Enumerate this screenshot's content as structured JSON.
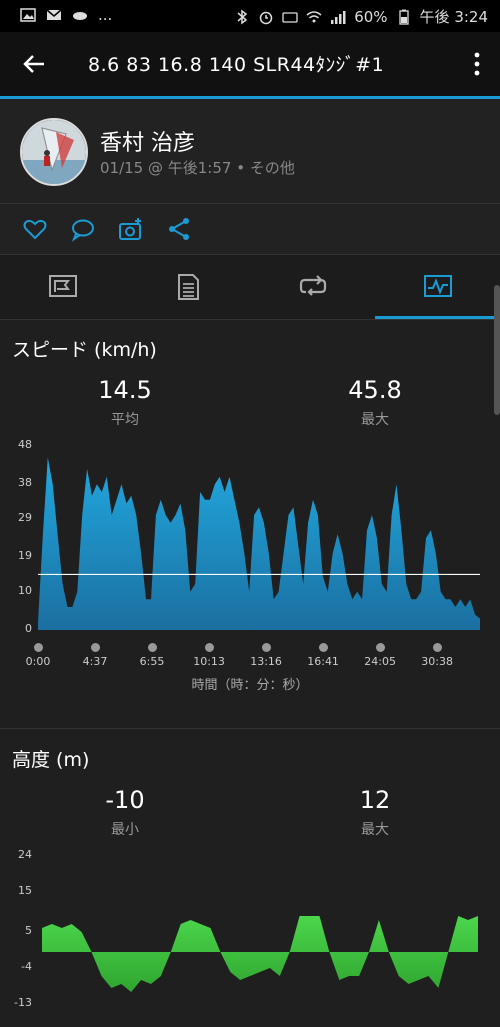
{
  "status_bar": {
    "left_icons": [
      "image-icon",
      "mail-icon",
      "cloud-icon"
    ],
    "overflow": "...",
    "battery": "60%",
    "time": "午後 3:24"
  },
  "header": {
    "title": "8.6  83  16.8   140   SLR44ﾀﾝｼﾞ#1"
  },
  "profile": {
    "name": "香村 治彦",
    "meta": "01/15 @ 午後1:57 • その他"
  },
  "actions": [
    "heart-icon",
    "comment-icon",
    "add-photo-icon",
    "share-icon"
  ],
  "tabs": [
    {
      "name": "summary",
      "icon": "flag-icon"
    },
    {
      "name": "details",
      "icon": "document-icon"
    },
    {
      "name": "laps",
      "icon": "loop-icon"
    },
    {
      "name": "charts",
      "icon": "chart-icon",
      "active": true
    }
  ],
  "speed": {
    "title": "スピード (km/h)",
    "avg_value": "14.5",
    "avg_label": "平均",
    "max_value": "45.8",
    "max_label": "最大",
    "y_ticks": [
      "48",
      "38",
      "29",
      "19",
      "10",
      "0"
    ],
    "x_ticks": [
      "0:00",
      "4:37",
      "6:55",
      "10:13",
      "13:16",
      "16:41",
      "24:05",
      "30:38"
    ],
    "x_caption": "時間（時：分：秒）"
  },
  "elevation": {
    "title": "高度 (m)",
    "min_value": "-10",
    "min_label": "最小",
    "max_value": "12",
    "max_label": "最大",
    "y_ticks": [
      "24",
      "15",
      "5",
      "-4",
      "-13"
    ]
  },
  "colors": {
    "accent": "#1a9bd4",
    "speed_fill": "#1e9ed2",
    "elevation_fill": "#3fbf3f",
    "background": "#1f1f1f"
  },
  "chart_data": [
    {
      "type": "area",
      "title": "スピード (km/h)",
      "xlabel": "時間（時：分：秒）",
      "ylabel": "",
      "ylim": [
        0,
        48
      ],
      "x_tick_labels": [
        "0:00",
        "4:37",
        "6:55",
        "10:13",
        "13:16",
        "16:41",
        "24:05",
        "30:38"
      ],
      "average_line": 14.5,
      "series": [
        {
          "values": [
            2,
            25,
            45,
            38,
            25,
            12,
            6,
            6,
            10,
            30,
            42,
            35,
            38,
            36,
            40,
            30,
            34,
            38,
            33,
            35,
            30,
            20,
            8,
            8,
            30,
            34,
            30,
            28,
            30,
            33,
            26,
            10,
            12,
            36,
            34,
            34,
            38,
            40,
            36,
            40,
            34,
            28,
            20,
            10,
            30,
            32,
            28,
            20,
            8,
            10,
            20,
            30,
            32,
            22,
            12,
            28,
            34,
            30,
            14,
            10,
            20,
            25,
            20,
            12,
            8,
            10,
            8,
            26,
            30,
            24,
            12,
            10,
            30,
            38,
            26,
            12,
            8,
            8,
            10,
            24,
            26,
            20,
            10,
            8,
            8,
            6,
            8,
            6,
            8,
            4,
            3
          ]
        }
      ]
    },
    {
      "type": "area",
      "title": "高度 (m)",
      "ylim": [
        -13,
        24
      ],
      "series": [
        {
          "values": [
            6,
            7,
            6,
            7,
            5,
            0,
            -6,
            -9,
            -8,
            -10,
            -7,
            -8,
            -6,
            0,
            7,
            8,
            7,
            6,
            0,
            -5,
            -7,
            -6,
            -5,
            -4,
            -6,
            0,
            9,
            9,
            9,
            0,
            -7,
            -6,
            -6,
            0,
            8,
            0,
            -6,
            -8,
            -7,
            -6,
            -9,
            0,
            9,
            8,
            9
          ]
        }
      ]
    }
  ]
}
